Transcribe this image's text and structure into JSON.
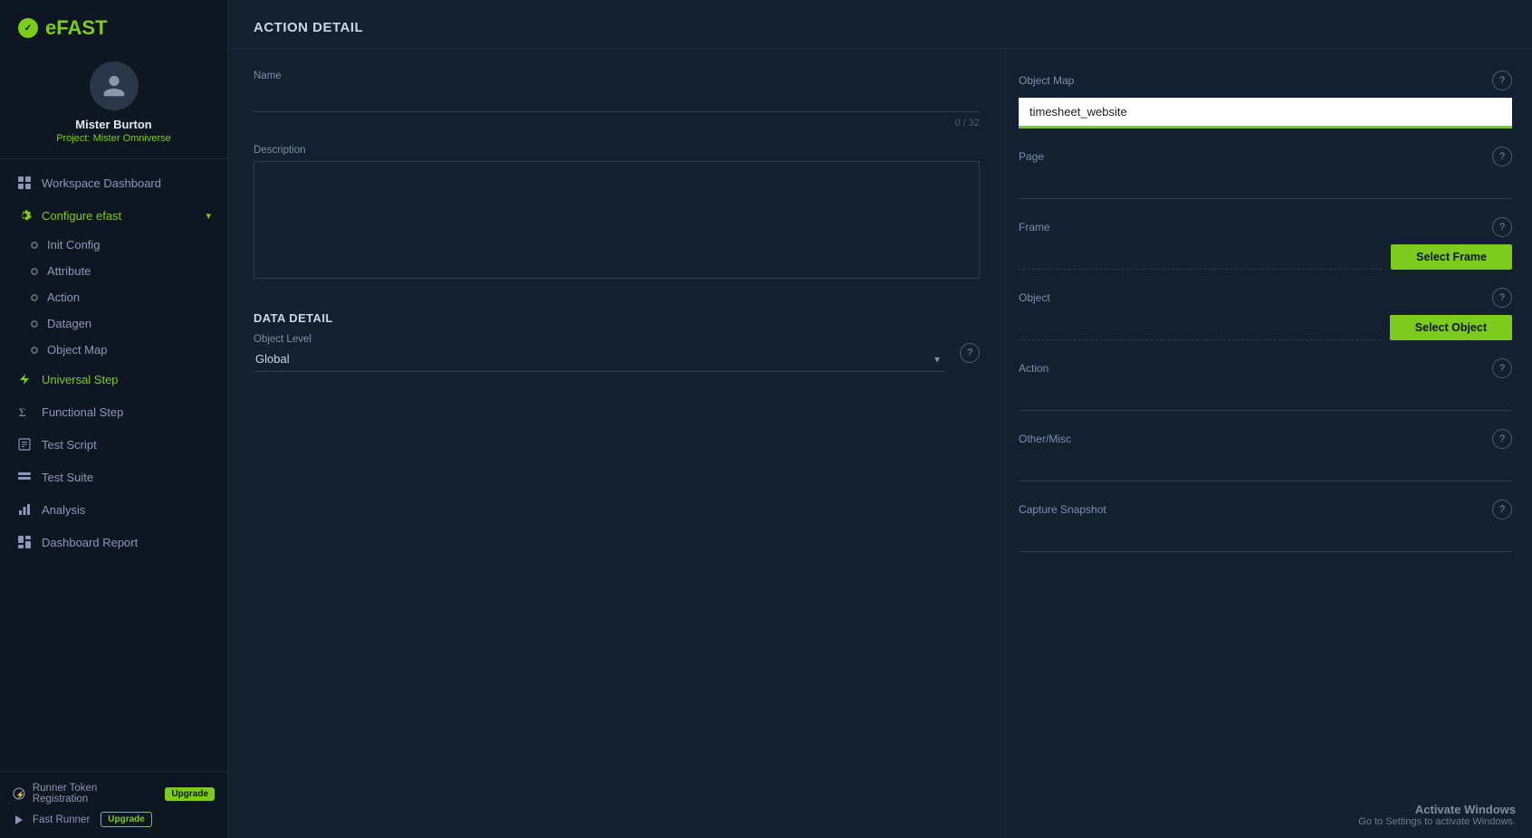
{
  "brand": {
    "logo_e": "e",
    "logo_fast": "FAST",
    "logo_symbol": "✓"
  },
  "user": {
    "name": "Mister Burton",
    "project_label": "Project:",
    "project_name": "Mister Omniverse"
  },
  "sidebar": {
    "items": [
      {
        "id": "workspace-dashboard",
        "label": "Workspace Dashboard",
        "icon": "grid",
        "active": false
      },
      {
        "id": "configure-efast",
        "label": "Configure efast",
        "icon": "gear",
        "active": true,
        "expandable": true
      },
      {
        "id": "init-config",
        "label": "Init Config",
        "icon": "dot",
        "sub": true
      },
      {
        "id": "attribute",
        "label": "Attribute",
        "icon": "dot",
        "sub": true
      },
      {
        "id": "action",
        "label": "Action",
        "icon": "dot",
        "sub": true,
        "active_sub": false
      },
      {
        "id": "datagen",
        "label": "Datagen",
        "icon": "dot",
        "sub": true
      },
      {
        "id": "object-map",
        "label": "Object Map",
        "icon": "dot",
        "sub": true
      },
      {
        "id": "universal-step",
        "label": "Universal Step",
        "icon": "lightning",
        "active": true
      },
      {
        "id": "functional-step",
        "label": "Functional Step",
        "icon": "sigma"
      },
      {
        "id": "test-script",
        "label": "Test Script",
        "icon": "script"
      },
      {
        "id": "test-suite",
        "label": "Test Suite",
        "icon": "suite"
      },
      {
        "id": "analysis",
        "label": "Analysis",
        "icon": "chart"
      },
      {
        "id": "dashboard-report",
        "label": "Dashboard Report",
        "icon": "dashboard"
      }
    ],
    "footer": [
      {
        "id": "runner-token",
        "label": "Runner Token Registration",
        "badge": "Upgrade"
      },
      {
        "id": "fast-runner",
        "label": "Fast Runner",
        "badge": "Upgrade"
      }
    ]
  },
  "page": {
    "title": "ACTION DETAIL"
  },
  "form": {
    "name_label": "Name",
    "name_value": "",
    "name_counter": "0 / 32",
    "description_label": "Description",
    "description_value": ""
  },
  "right_panel": {
    "object_map_label": "Object Map",
    "object_map_value": "timesheet_website",
    "page_label": "Page",
    "page_value": "",
    "frame_label": "Frame",
    "frame_btn": "Select Frame",
    "object_label": "Object",
    "object_btn": "Select Object",
    "action_label": "Action",
    "action_value": "",
    "other_misc_label": "Other/Misc",
    "other_misc_value": ""
  },
  "data_detail": {
    "title": "DATA DETAIL",
    "object_level_label": "Object Level",
    "object_level_value": "Global",
    "capture_snapshot_label": "Capture Snapshot",
    "capture_snapshot_value": ""
  },
  "windows": {
    "line1": "Activate Windows",
    "line2": "Go to Settings to activate Windows."
  }
}
